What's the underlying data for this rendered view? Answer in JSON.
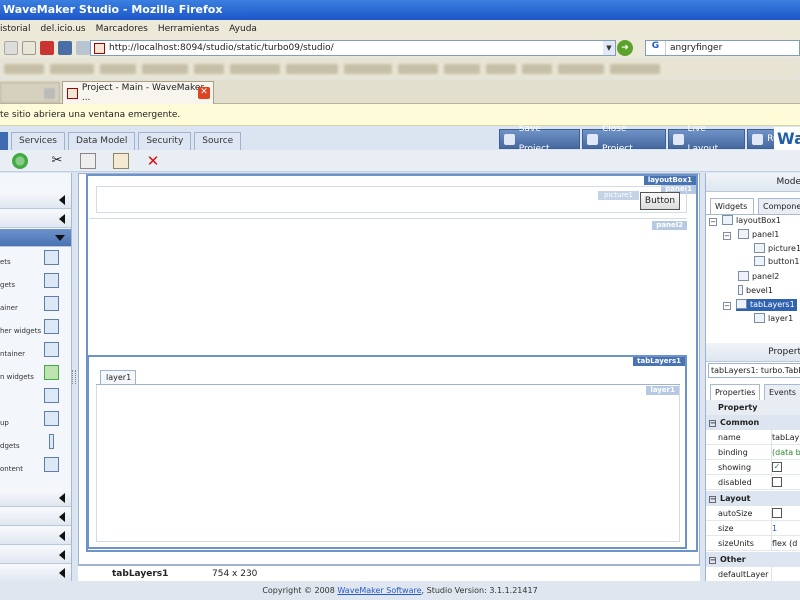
{
  "window": {
    "title": "WaveMaker Studio - Mozilla Firefox"
  },
  "menu": [
    "istorial",
    "del.icio.us",
    "Marcadores",
    "Herramientas",
    "Ayuda"
  ],
  "nav": {
    "url": "http://localhost:8094/studio/static/turbo09/studio/",
    "search_value": "angryfinger"
  },
  "tabs": {
    "active_label": "Project - Main - WaveMaker ..."
  },
  "notice": {
    "text": "te sitio abriera una ventana emergente."
  },
  "studio": {
    "tabs": [
      "Services",
      "Data Model",
      "Security",
      "Source"
    ],
    "actions": [
      "Save Project",
      "Close Project",
      "Live Layout",
      "Run..."
    ],
    "logo_text": "Wa"
  },
  "palette": {
    "items": [
      "ets",
      "gets",
      "ainer",
      "her widgets",
      "ntainer",
      "n widgets",
      "",
      "up",
      "dgets",
      "ontent"
    ]
  },
  "canvas": {
    "layoutbox_label": "layoutBox1",
    "panel1_label": "panel1",
    "picture_label": "picture1",
    "button_label": "Button",
    "panel2_label": "panel2",
    "tablayers_label": "tabLayers1",
    "layer_tab": "layer1",
    "layer_label": "layer1",
    "status_name": "tabLayers1",
    "status_size": "754 x 230"
  },
  "footer": {
    "prefix": "Copyright © 2008 ",
    "link": "WaveMaker Software",
    "suffix": ", Studio Version: 3.1.1.21417"
  },
  "model": {
    "title": "Mode",
    "tab_widgets": "Widgets",
    "tab_components": "Compone",
    "tree": [
      "layoutBox1",
      "panel1",
      "picture1",
      "button1",
      "panel2",
      "bevel1",
      "tabLayers1",
      "layer1"
    ]
  },
  "properties": {
    "title": "Propert",
    "selected": "tabLayers1: turbo.TabLa",
    "tab_properties": "Properties",
    "tab_events": "Events",
    "header": "Property",
    "groups": {
      "common": "Common",
      "layout": "Layout",
      "other": "Other"
    },
    "rows": {
      "name_k": "name",
      "name_v": "tabLay",
      "binding_k": "binding",
      "binding_v": "(data b",
      "showing_k": "showing",
      "disabled_k": "disabled",
      "autosize_k": "autoSize",
      "size_k": "size",
      "size_v": "1",
      "sizeunits_k": "sizeUnits",
      "sizeunits_v": "flex (d",
      "defaultlayer_k": "defaultLayer"
    },
    "showing_checked": true,
    "disabled_checked": false,
    "autosize_checked": false
  }
}
